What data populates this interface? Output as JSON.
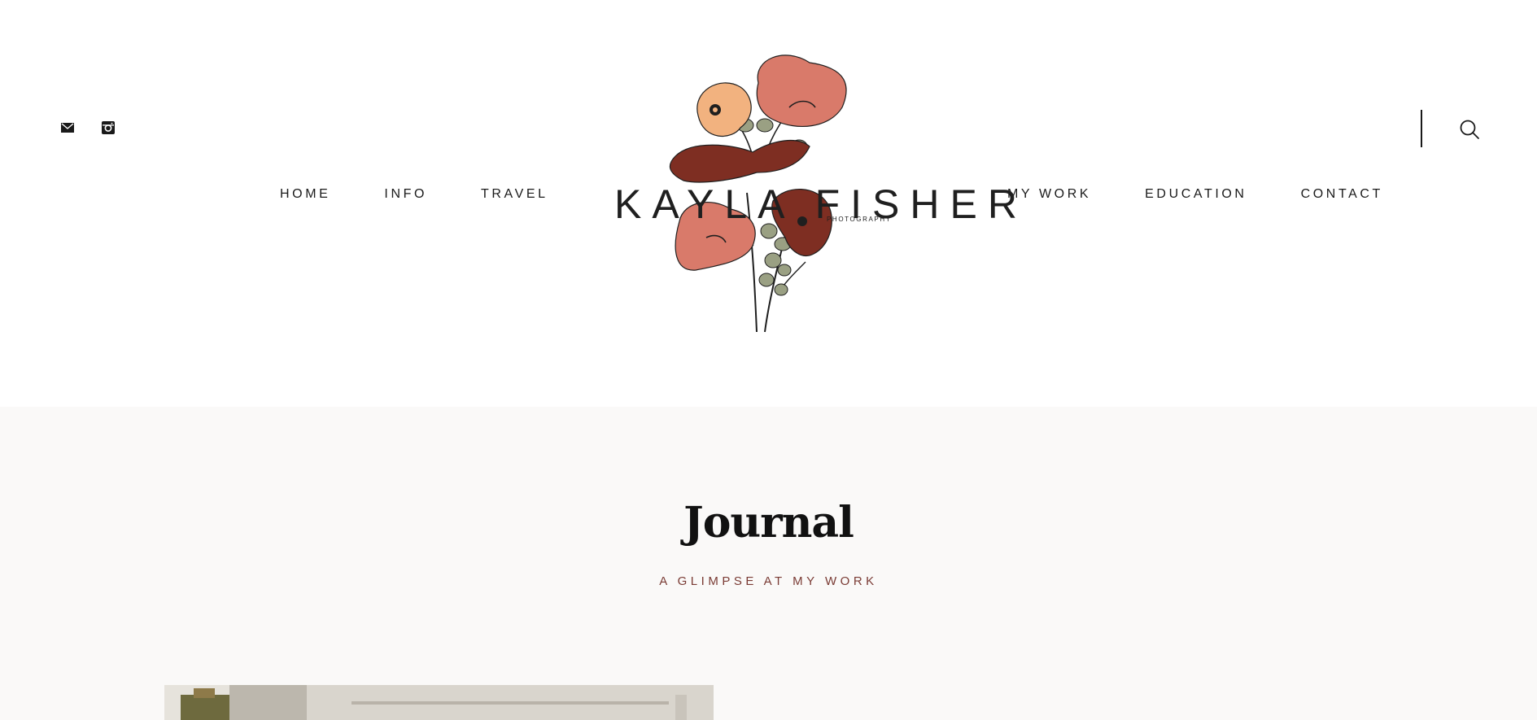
{
  "header": {
    "social": [
      {
        "name": "email",
        "icon": "mail-icon"
      },
      {
        "name": "instagram",
        "icon": "instagram-icon"
      }
    ],
    "search_icon": "search-icon"
  },
  "logo": {
    "title": "KAYLA FISHER",
    "subtitle": "PHOTOGRAPHY",
    "colors": {
      "coral": "#d97a6a",
      "peach": "#f2b27f",
      "rust": "#7e2e22",
      "sage": "#9aa083",
      "ink": "#1f1f1f"
    }
  },
  "nav": {
    "left": [
      {
        "label": "HOME"
      },
      {
        "label": "INFO"
      },
      {
        "label": "TRAVEL"
      }
    ],
    "right": [
      {
        "label": "MY WORK"
      },
      {
        "label": "EDUCATION"
      },
      {
        "label": "CONTACT"
      }
    ]
  },
  "journal": {
    "title": "Journal",
    "subtitle": "A GLIMPSE AT MY WORK"
  },
  "colors": {
    "accent": "#7a3b34",
    "background_light": "#faf9f8",
    "text": "#1a1a1a"
  }
}
